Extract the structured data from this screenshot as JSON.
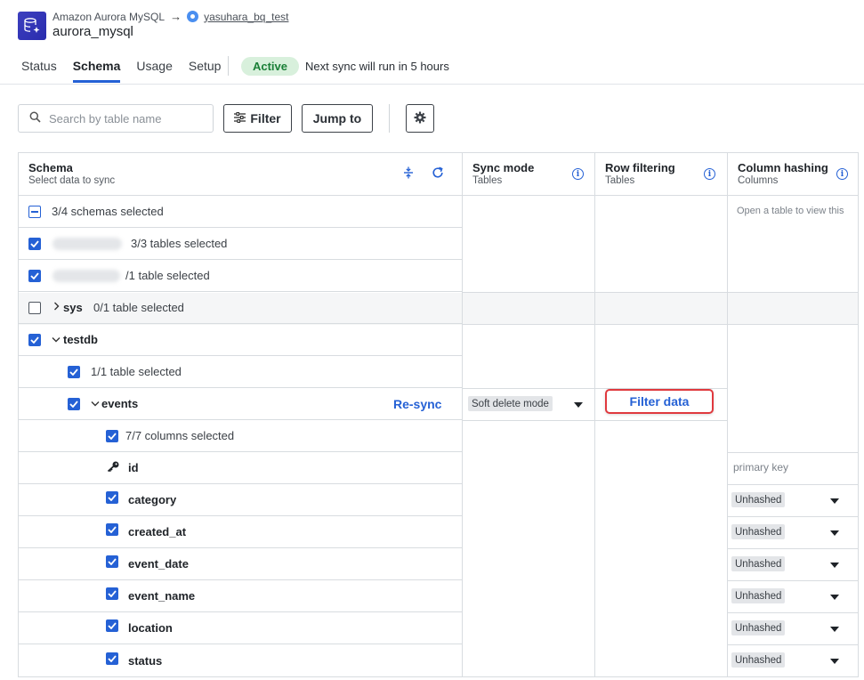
{
  "header": {
    "source_name": "Amazon Aurora MySQL",
    "destination_name": "yasuhara_bq_test",
    "connection_name": "aurora_mysql"
  },
  "tabs": [
    {
      "label": "Status"
    },
    {
      "label": "Schema"
    },
    {
      "label": "Usage"
    },
    {
      "label": "Setup"
    }
  ],
  "status": {
    "badge": "Active",
    "next_sync": "Next sync will run in 5 hours",
    "badge_color": "#1a7f37"
  },
  "toolbar": {
    "search_placeholder": "Search by table name",
    "filter_label": "Filter",
    "jump_label": "Jump to"
  },
  "columns": {
    "schema": {
      "title": "Schema",
      "subtitle": "Select data to sync"
    },
    "sync_mode": {
      "title": "Sync mode",
      "subtitle": "Tables"
    },
    "row_filtering": {
      "title": "Row filtering",
      "subtitle": "Tables"
    },
    "column_hashing": {
      "title": "Column hashing",
      "subtitle": "Columns",
      "hint": "Open a table to view this"
    }
  },
  "tree": {
    "summary": "3/4 schemas selected",
    "schema1_tables": "3/3 tables selected",
    "schema2_tables": "/1 table selected",
    "sys": {
      "name": "sys",
      "tables": "0/1 table selected"
    },
    "testdb": {
      "name": "testdb",
      "tables": "1/1 table selected"
    },
    "events": {
      "name": "events",
      "resync_label": "Re-sync",
      "sync_mode": "Soft delete mode",
      "filter_label": "Filter data",
      "columns_summary": "7/7 columns selected",
      "columns": [
        {
          "name": "id",
          "hashing": "primary key"
        },
        {
          "name": "category",
          "hashing": "Unhashed"
        },
        {
          "name": "created_at",
          "hashing": "Unhashed"
        },
        {
          "name": "event_date",
          "hashing": "Unhashed"
        },
        {
          "name": "event_name",
          "hashing": "Unhashed"
        },
        {
          "name": "location",
          "hashing": "Unhashed"
        },
        {
          "name": "status",
          "hashing": "Unhashed"
        }
      ]
    }
  },
  "colors": {
    "accent": "#2561d5",
    "highlight": "#e0393e"
  }
}
